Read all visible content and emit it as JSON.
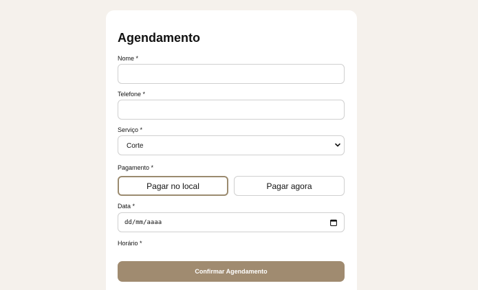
{
  "form": {
    "title": "Agendamento",
    "nome_label": "Nome *",
    "nome_value": "",
    "telefone_label": "Telefone *",
    "telefone_value": "",
    "servico_label": "Serviço *",
    "servico_selected": "Corte",
    "pagamento_label": "Pagamento *",
    "pagamento_options": [
      "Pagar no local",
      "Pagar agora"
    ],
    "pagamento_selected": "Pagar no local",
    "data_label": "Data *",
    "data_placeholder": "dd/mm/aaaa",
    "horario_label": "Horário *",
    "submit_label": "Confirmar Agendamento"
  },
  "colors": {
    "page_background": "#f5f1ec",
    "card_background": "#ffffff",
    "accent": "#a08b70",
    "selected_border": "#9a8a6e"
  },
  "icons": {
    "select_chevron": "chevron-down-icon",
    "date_picker": "calendar-icon"
  }
}
